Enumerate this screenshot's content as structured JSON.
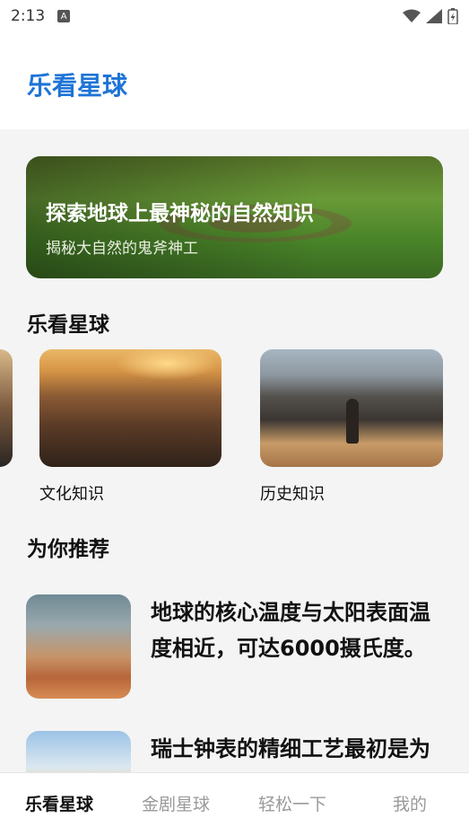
{
  "status": {
    "time": "2:13",
    "notif_letter": "A",
    "icons": [
      "wifi-icon",
      "signal-icon",
      "battery-icon"
    ]
  },
  "header": {
    "title": "乐看星球"
  },
  "banner": {
    "title": "探索地球上最神秘的自然知识",
    "subtitle": "揭秘大自然的鬼斧神工"
  },
  "categories_section": {
    "title": "乐看星球",
    "items": [
      {
        "label": "文化知识"
      },
      {
        "label": "历史知识"
      }
    ]
  },
  "recommend_section": {
    "title": "为你推荐",
    "items": [
      {
        "text": "地球的核心温度与太阳表面温度相近，可达6000摄氏度。"
      },
      {
        "text": "瑞士钟表的精细工艺最初是为了配合宗教时间上的精准"
      }
    ]
  },
  "bottom_nav": {
    "items": [
      {
        "label": "乐看星球",
        "active": true
      },
      {
        "label": "金剧星球",
        "active": false
      },
      {
        "label": "轻松一下",
        "active": false
      },
      {
        "label": "我的",
        "active": false
      }
    ]
  },
  "colors": {
    "accent": "#1e74d6",
    "background": "#f4f4f4",
    "inactive_nav": "#9a9a9a"
  }
}
